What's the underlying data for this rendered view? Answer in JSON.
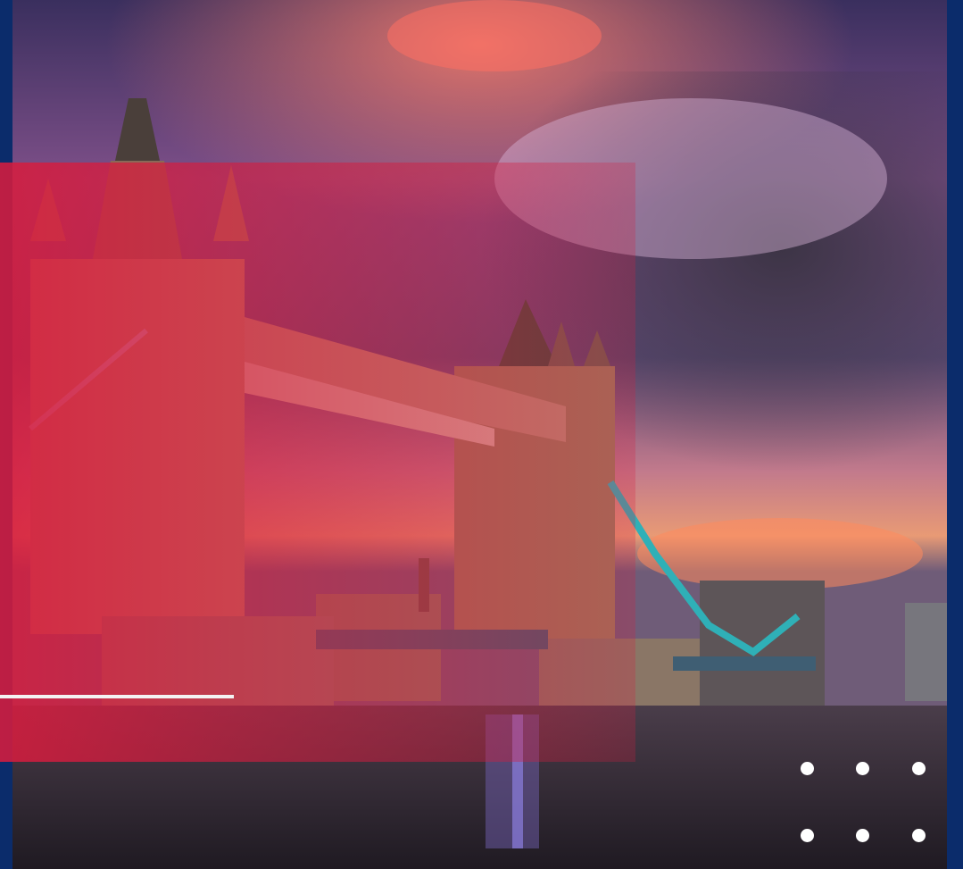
{
  "scene": {
    "subject": "",
    "colors": {
      "frame": "#0b2c6b",
      "overlay": "#d61c3e",
      "accent_line": "#f3f3f3",
      "dots": "#ffffff"
    }
  },
  "decor": {
    "dot_grid": {
      "rows": 2,
      "cols": 3
    }
  }
}
